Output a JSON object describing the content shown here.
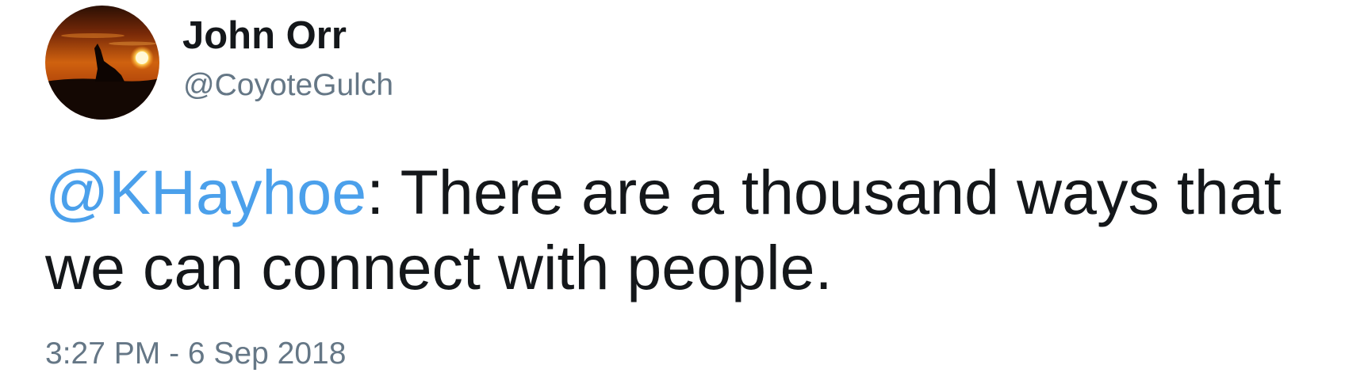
{
  "author": {
    "display_name": "John Orr",
    "handle": "@CoyoteGulch",
    "avatar": "coyote-sunset-avatar"
  },
  "tweet": {
    "mention": "@KHayhoe",
    "text": ": There are a thousand ways that we can connect with people.",
    "timestamp": "3:27 PM - 6 Sep 2018"
  },
  "colors": {
    "text": "#14171a",
    "secondary": "#657786",
    "mention": "#4ba0eb"
  }
}
